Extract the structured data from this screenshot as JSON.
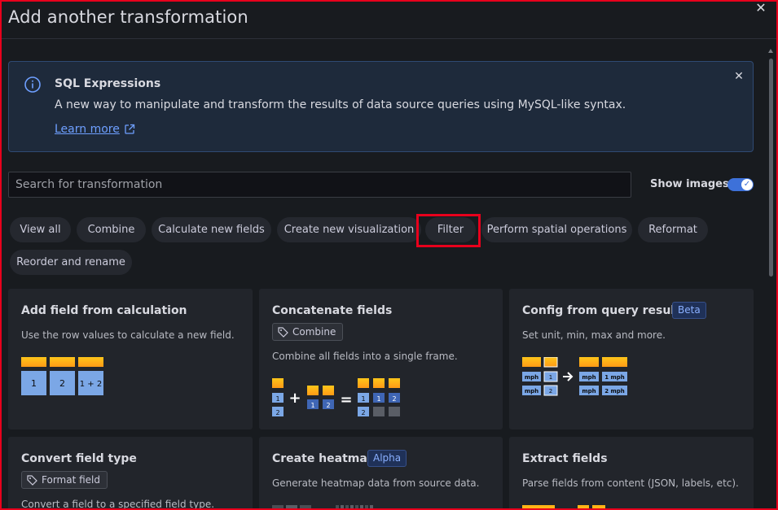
{
  "modal": {
    "title": "Add another transformation",
    "close_icon": "close-icon"
  },
  "banner": {
    "title": "SQL Expressions",
    "text": "A new way to manipulate and transform the results of data source queries using MySQL-like syntax.",
    "link_label": "Learn more"
  },
  "search": {
    "placeholder": "Search for transformation",
    "value": ""
  },
  "show_images": {
    "label": "Show images",
    "enabled": true
  },
  "filters": [
    {
      "label": "View all"
    },
    {
      "label": "Combine"
    },
    {
      "label": "Calculate new fields"
    },
    {
      "label": "Create new visualization"
    },
    {
      "label": "Filter"
    },
    {
      "label": "Perform spatial operations"
    },
    {
      "label": "Reformat"
    },
    {
      "label": "Reorder and rename"
    }
  ],
  "highlighted_filter": "Filter",
  "cards": [
    {
      "title": "Add field from calculation",
      "description": "Use the row values to calculate a new field.",
      "cells": [
        "1",
        "2",
        "1 + 2"
      ]
    },
    {
      "title": "Concatenate fields",
      "tag": "Combine",
      "description": "Combine all fields into a single frame.",
      "cells": [
        "1",
        "2",
        "1",
        "2",
        "1",
        "1",
        "2",
        "2"
      ]
    },
    {
      "title": "Config from query results",
      "badge": "Beta",
      "description": "Set unit, min, max and more.",
      "cells": [
        "mph",
        "1",
        "mph",
        "2",
        "mph",
        "1 mph",
        "mph",
        "2 mph"
      ]
    },
    {
      "title": "Convert field type",
      "tag": "Format field",
      "description": "Convert a field to a specified field type."
    },
    {
      "title": "Create heatmap",
      "badge": "Alpha",
      "description": "Generate heatmap data from source data."
    },
    {
      "title": "Extract fields",
      "description": "Parse fields from content (JSON, labels, etc)."
    }
  ],
  "colors": {
    "background": "#181b1f",
    "card": "#22252b",
    "accent": "#3d71d9",
    "cell_blue": "#7ba7e6",
    "cell_header": "#ffb516",
    "highlight": "#e8001c"
  }
}
